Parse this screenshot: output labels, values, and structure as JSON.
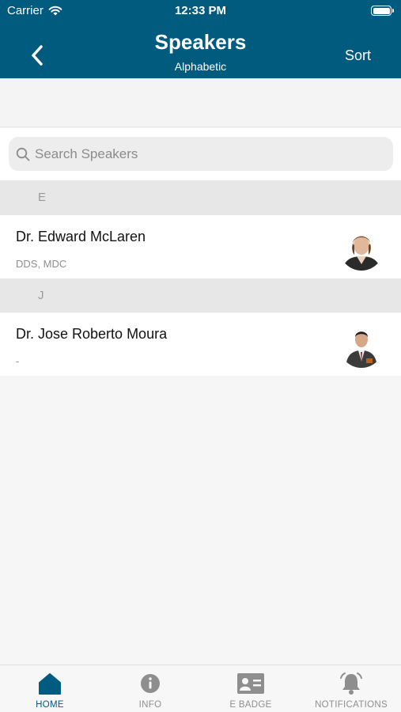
{
  "status_bar": {
    "carrier": "Carrier",
    "time": "12:33 PM"
  },
  "nav": {
    "title": "Speakers",
    "subtitle": "Alphabetic",
    "sort_label": "Sort"
  },
  "search": {
    "placeholder": "Search Speakers",
    "value": ""
  },
  "sections": [
    {
      "letter": "E",
      "speakers": [
        {
          "name": "Dr. Edward McLaren",
          "credentials": "DDS, MDC"
        }
      ]
    },
    {
      "letter": "J",
      "speakers": [
        {
          "name": "Dr. Jose Roberto Moura",
          "credentials": "-"
        }
      ]
    }
  ],
  "tabs": [
    {
      "label": "HOME",
      "icon": "home-icon",
      "active": true
    },
    {
      "label": "INFO",
      "icon": "info-icon",
      "active": false
    },
    {
      "label": "E BADGE",
      "icon": "badge-icon",
      "active": false
    },
    {
      "label": "NOTIFICATIONS",
      "icon": "bell-icon",
      "active": false
    }
  ],
  "colors": {
    "header": "#005b7f",
    "accent": "#005b7f",
    "inactive": "#8e8e8e"
  }
}
